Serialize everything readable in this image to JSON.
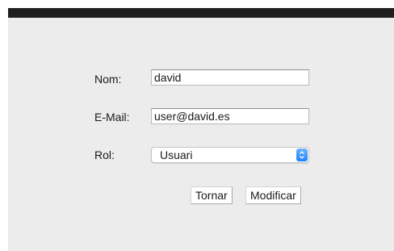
{
  "form": {
    "name_label": "Nom:",
    "name_value": "david",
    "email_label": "E-Mail:",
    "email_value": "user@david.es",
    "role_label": "Rol:",
    "role_value": "Usuari"
  },
  "buttons": {
    "back_label": "Tornar",
    "modify_label": "Modificar"
  },
  "colors": {
    "select_arrow_accent": "#1a82fb",
    "top_bar": "#1e1e1e",
    "panel_background": "#ececec"
  },
  "icons": {
    "select_arrows": "up-down-chevron-icon"
  }
}
